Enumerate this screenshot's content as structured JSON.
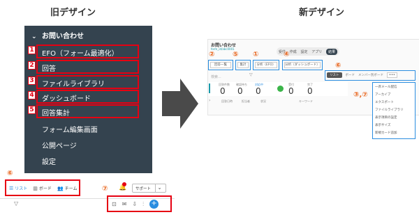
{
  "headings": {
    "old": "旧デザイン",
    "new": "新デザイン"
  },
  "old_sidebar": {
    "header": "お問い合わせ",
    "items": [
      "EFO（フォーム最適化）",
      "回答",
      "ファイルライブラリ",
      "ダッシュボード",
      "回答集計",
      "フォーム編集画面",
      "公開ページ",
      "設定"
    ]
  },
  "markers": [
    "1",
    "2",
    "3",
    "4",
    "5"
  ],
  "circled": {
    "six_old": "⑥",
    "seven_old": "⑦",
    "two": "②",
    "five": "⑤",
    "one": "①",
    "four": "④",
    "six_new": "⑥",
    "three_seven": "③,⑦"
  },
  "old_toolbar": {
    "list": "リスト",
    "board": "ボード",
    "team": "チーム",
    "support": "サポート"
  },
  "new_design": {
    "title": "お問い合わせ",
    "subtitle": "form_id/abc0001",
    "nav": [
      "受付",
      "作成",
      "設定",
      "アプリ",
      "結果"
    ],
    "actions": [
      "回答一覧",
      "集計",
      "分析（EFO）",
      "分析（ダッシュボード）"
    ],
    "view_tabs": [
      "リスト",
      "ボード",
      "メンバー別ボード"
    ],
    "search_placeholder": "検索...",
    "stats": [
      {
        "label": "回答件数",
        "value": "0"
      },
      {
        "label": "確認待ち",
        "value": "0"
      },
      {
        "label": "対応中",
        "value": "0"
      },
      {
        "label": "受付",
        "value": "0"
      },
      {
        "label": "完了",
        "value": "0"
      }
    ],
    "columns": [
      "回答日時",
      "担当者",
      "状況",
      "キーワード"
    ],
    "menu": [
      "一斉メール配信",
      "アーカイブ",
      "エクスポート",
      "ファイルライブラリ",
      "表示項目の設定",
      "表示サイズ",
      "新規カード追加"
    ]
  },
  "colors": {
    "sidebar": "#34434f",
    "red": "#e60012",
    "orange": "#e8641b",
    "teal": "#1b9aaa",
    "blue": "#2a8de0"
  }
}
